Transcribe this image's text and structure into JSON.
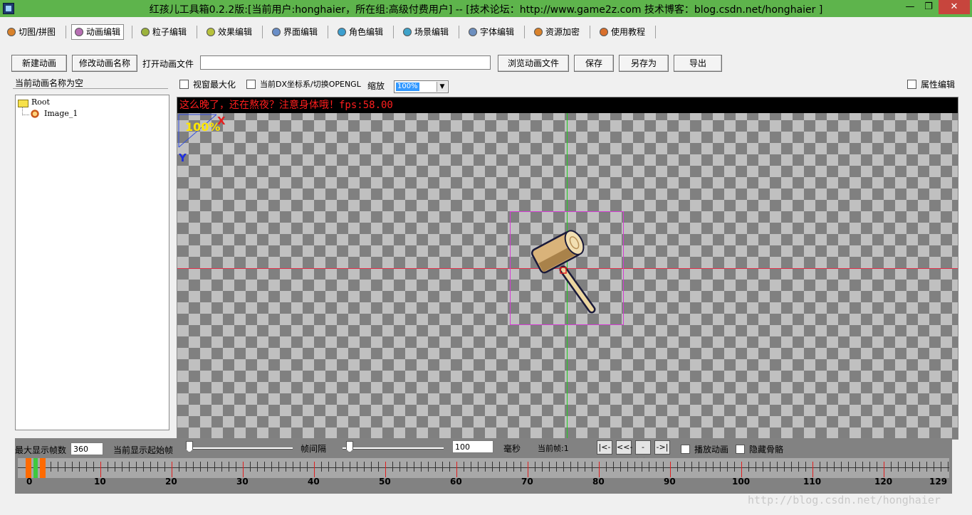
{
  "window": {
    "title": "红孩儿工具箱0.2.2版:[当前用户:honghaier，所在组:高级付费用户]  --  [技术论坛：http://www.game2z.com 技术博客：blog.csdn.net/honghaier ]",
    "min_glyph": "—",
    "max_glyph": "❐",
    "close_glyph": "✕"
  },
  "tabs": [
    {
      "label": "切图/拼图",
      "color": "#d9822b"
    },
    {
      "label": "动画编辑",
      "color": "#b76fb3"
    },
    {
      "label": "粒子编辑",
      "color": "#9cb33c"
    },
    {
      "label": "效果编辑",
      "color": "#b8c23c"
    },
    {
      "label": "界面编辑",
      "color": "#6a8fc8"
    },
    {
      "label": "角色编辑",
      "color": "#3c9fcf"
    },
    {
      "label": "场景编辑",
      "color": "#3fa3c9"
    },
    {
      "label": "字体编辑",
      "color": "#6d8fbf"
    },
    {
      "label": "资源加密",
      "color": "#d9822b"
    },
    {
      "label": "使用教程",
      "color": "#d96f2b"
    }
  ],
  "toolbar": {
    "new_anim": "新建动画",
    "rename_anim": "修改动画名称",
    "open_file_label": "打开动画文件",
    "open_file_value": "",
    "browse": "浏览动画文件",
    "save": "保存",
    "save_as": "另存为",
    "export": "导出"
  },
  "anim_name_label": "当前动画名称为空",
  "options": {
    "maximize_label": "视窗最大化",
    "dx_coord_label": "当前DX坐标系/切换OPENGL",
    "zoom_label": "缩放",
    "zoom_value": "100%",
    "property_edit_label": "属性编辑"
  },
  "tree": {
    "root": "Root",
    "child": "Image_1"
  },
  "canvas": {
    "fps_text": "这么晚了，还在熬夜？注意身体哦！fps:58.00",
    "zoom_text": "100%",
    "axis_x": "X",
    "axis_y": "Y"
  },
  "timeline": {
    "max_frames_label": "最大显示帧数",
    "max_frames_value": "360",
    "start_frame_label": "当前显示起始帧",
    "interval_label": "帧间隔",
    "interval_value": "100",
    "ms_label": "毫秒",
    "current_frame_label": "当前帧:1",
    "nav": [
      "|<-",
      "<<-",
      "->>",
      "->|"
    ],
    "play_label": "播放动画",
    "hide_bones_label": "隐藏骨骼",
    "ruler_labels": [
      "0",
      "10",
      "20",
      "30",
      "40",
      "50",
      "60",
      "70",
      "80",
      "90",
      "100",
      "110",
      "120",
      "129"
    ]
  },
  "watermark": "http://blog.csdn.net/honghaier"
}
